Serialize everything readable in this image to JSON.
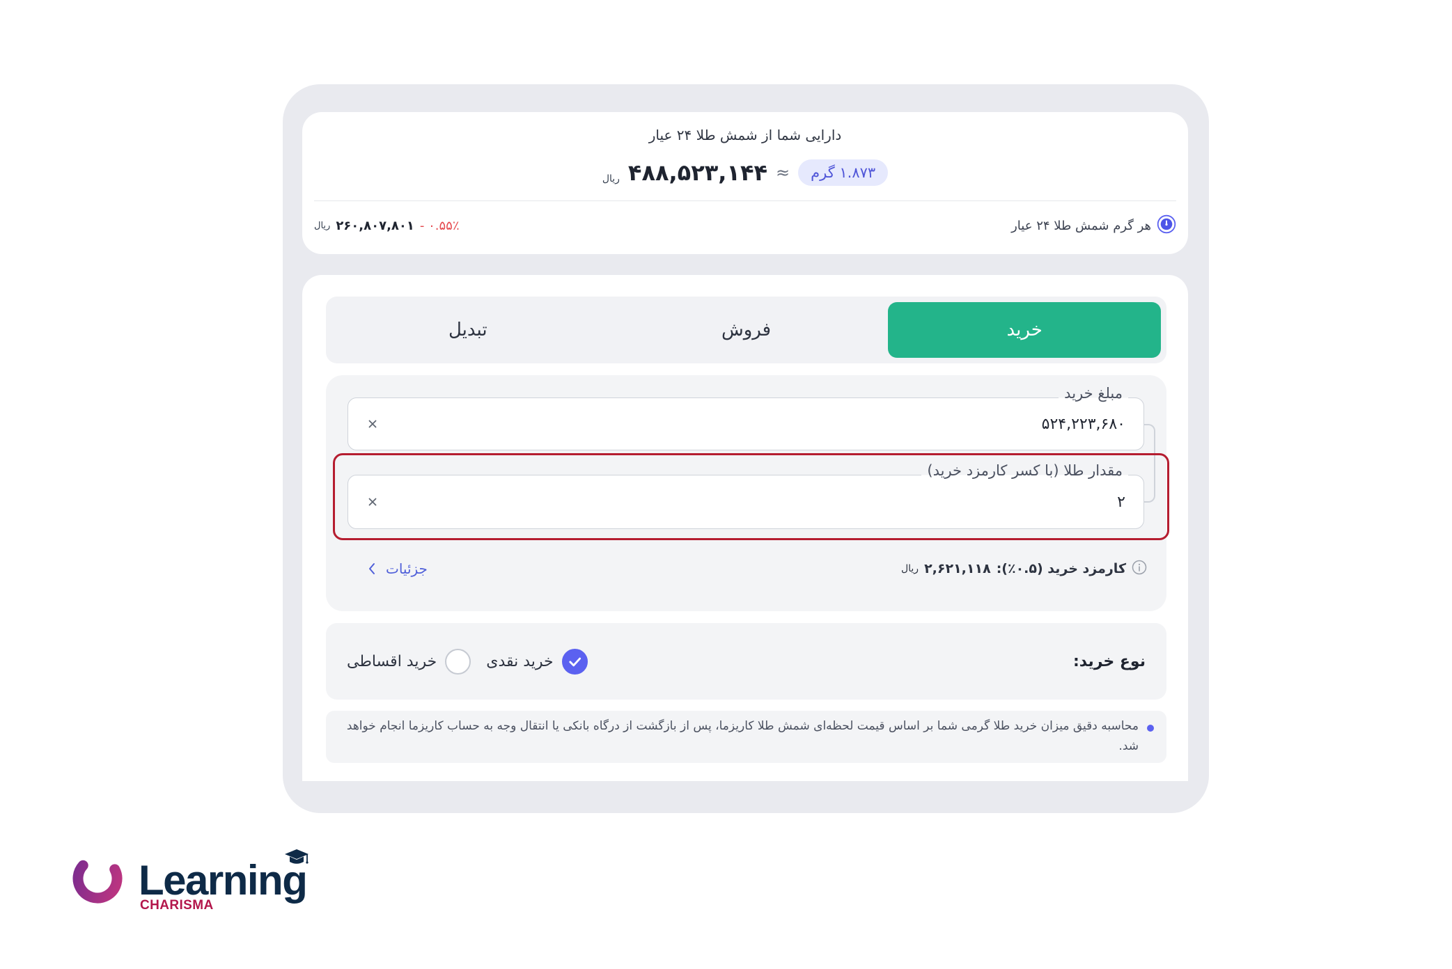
{
  "holdings": {
    "title": "دارایی شما از شمش طلا ۲۴ عیار",
    "grams": "۱.۸۷۳ گرم",
    "approx": "≈",
    "value": "۴۸۸,۵۲۳,۱۴۴",
    "currency": "ریال",
    "price_label": "هر گرم شمش طلا ۲۴ عیار",
    "price_value": "۲۶۰,۸۰۷,۸۰۱",
    "price_currency": "ریال",
    "price_change": "- ۰.۵۵٪"
  },
  "tabs": [
    {
      "label": "خرید",
      "active": true
    },
    {
      "label": "فروش",
      "active": false
    },
    {
      "label": "تبدیل",
      "active": false
    }
  ],
  "form": {
    "amount": {
      "label": "مبلغ خرید",
      "value": "۵۲۴,۲۲۳,۶۸۰"
    },
    "gold": {
      "label": "مقدار طلا (با کسر کارمزد خرید)",
      "value": "۲"
    },
    "fee_label": "کارمزد خرید (۰.۵٪):",
    "fee_value": "۲,۶۲۱,۱۱۸",
    "fee_currency": "ریال",
    "details_label": "جزئیات"
  },
  "purchase_type": {
    "label": "نوع خرید:",
    "options": [
      {
        "label": "خرید نقدی",
        "checked": true
      },
      {
        "label": "خرید اقساطی",
        "checked": false
      }
    ]
  },
  "note": {
    "text": "محاسبه دقیق میزان خرید طلا گرمی شما بر اساس قیمت لحظه‌ای شمش طلا کاریزما، پس از بازگشت از درگاه بانکی یا انتقال وجه به حساب کاریزما انجام خواهد شد."
  },
  "branding": {
    "name": "Learning",
    "sub": "CHARISMA"
  },
  "colors": {
    "accent_green": "#23b48a",
    "accent_blue": "#5b61f0",
    "highlight_red": "#b51d30",
    "negative_red": "#e5484d",
    "brand_navy": "#0e2a47",
    "brand_pink": "#b3164b",
    "panel_bg": "#e9eaef"
  },
  "icons": {
    "price": "timer-icon",
    "clear": "close-icon",
    "fee": "info-icon",
    "details": "chevron-left-icon",
    "radio_checked": "check-icon",
    "note_bullet": "bullet-dot",
    "logo": "logo-ring-icon",
    "logo_cap": "graduation-cap-icon"
  }
}
